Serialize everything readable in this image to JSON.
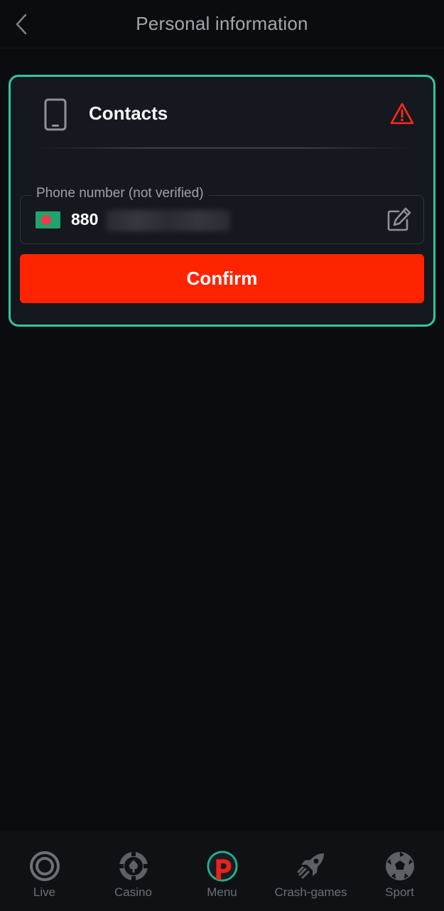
{
  "header": {
    "title": "Personal information",
    "back_icon": "chevron-left-icon"
  },
  "card": {
    "title": "Contacts",
    "icon": "smartphone-icon",
    "status_icon": "warning-triangle-icon",
    "border_color": "#2ec7a1",
    "warning_color": "#ff2c1a",
    "phone_field": {
      "label": "Phone number (not verified)",
      "country_code": "880",
      "flag": "bangladesh-flag-icon",
      "edit_icon": "edit-icon"
    },
    "confirm_label": "Confirm",
    "confirm_color": "#ff2400"
  },
  "nav": {
    "items": [
      {
        "label": "Live",
        "icon": "live-target-icon"
      },
      {
        "label": "Casino",
        "icon": "casino-chip-icon"
      },
      {
        "label": "Menu",
        "icon": "menu-logo-icon"
      },
      {
        "label": "Crash-games",
        "icon": "rocket-icon"
      },
      {
        "label": "Sport",
        "icon": "soccer-ball-icon"
      }
    ]
  }
}
